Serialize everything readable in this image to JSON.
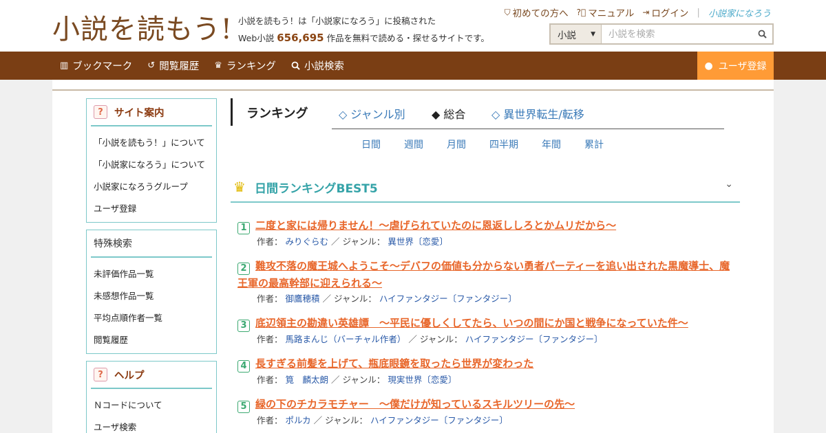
{
  "header": {
    "logo": "小説を読もう!",
    "tagline_line1": "小説を読もう！は「小説家になろう」に投稿された",
    "tagline_prefix": "Web小説",
    "novel_count": "656,695",
    "tagline_suffix": "作品を無料で読める・探せるサイトです。",
    "links": [
      {
        "label": "初めての方へ",
        "icon": "shield-icon"
      },
      {
        "label": "マニュアル",
        "icon": "question-circle-icon"
      },
      {
        "label": "ログイン",
        "icon": "login-icon"
      }
    ],
    "narou_logo": "小説家になろう"
  },
  "search": {
    "type_selected": "小説",
    "placeholder": "小説を検索"
  },
  "nav": {
    "items": [
      {
        "label": "ブックマーク",
        "icon": "bookmark-icon"
      },
      {
        "label": "閲覧履歴",
        "icon": "history-icon"
      },
      {
        "label": "ランキング",
        "icon": "crown-icon"
      },
      {
        "label": "小説検索",
        "icon": "search-icon"
      }
    ],
    "register": "ユーザ登録"
  },
  "sidebar": {
    "site_guide": {
      "title": "サイト案内",
      "items": [
        "「小説を読もう！」について",
        "「小説家になろう」について",
        "小説家になろうグループ",
        "ユーザ登録"
      ]
    },
    "special_search": {
      "title": "特殊検索",
      "items": [
        "未評価作品一覧",
        "未感想作品一覧",
        "平均点順作者一覧",
        "閲覧履歴"
      ]
    },
    "help": {
      "title": "ヘルプ",
      "items": [
        "Ｎコードについて",
        "ユーザ検索"
      ]
    }
  },
  "ranking": {
    "title": "ランキング",
    "tabs": [
      "◇ ジャンル別",
      "◆ 総合",
      "◇ 異世界転生/転移"
    ],
    "periods": [
      "日間",
      "週間",
      "月間",
      "四半期",
      "年間",
      "累計"
    ],
    "section_title": "日間ランキングBEST5",
    "author_label": "作者：",
    "genre_label": "／ ジャンル：",
    "entries": [
      {
        "rank": "1",
        "title": "二度と家には帰りません！～虐げられていたのに恩返ししろとかムリだから～",
        "author": "みりぐらむ",
        "genre": "異世界〔恋愛〕"
      },
      {
        "rank": "2",
        "title": "難攻不落の魔王城へようこそ～デバフの価値も分からない勇者パーティーを追い出された黒魔導士、魔王軍の最高幹部に迎えられる～",
        "author": "御鷹穂積",
        "genre": "ハイファンタジー〔ファンタジー〕"
      },
      {
        "rank": "3",
        "title": "底辺領主の勘違い英雄譚　～平民に優しくしてたら、いつの間にか国と戦争になっていた件～",
        "author": "馬路まんじ（バーチャル作者）",
        "genre": "ハイファンタジー〔ファンタジー〕"
      },
      {
        "rank": "4",
        "title": "長すぎる前髪を上げて、瓶底眼鏡を取ったら世界が変わった",
        "author": "筧　麟太朗",
        "genre": "現実世界〔恋愛〕"
      },
      {
        "rank": "5",
        "title": "緑の下のチカラモチャー　～僕だけが知っているスキルツリーの先～",
        "author": "ポルカ",
        "genre": "ハイファンタジー〔ファンタジー〕"
      }
    ]
  },
  "colors": {
    "brown": "#7a3e14",
    "orange": "#ff9b36",
    "teal": "#7cc8c9",
    "link_orange": "#e8662a",
    "link_blue": "#2a5aa8"
  }
}
